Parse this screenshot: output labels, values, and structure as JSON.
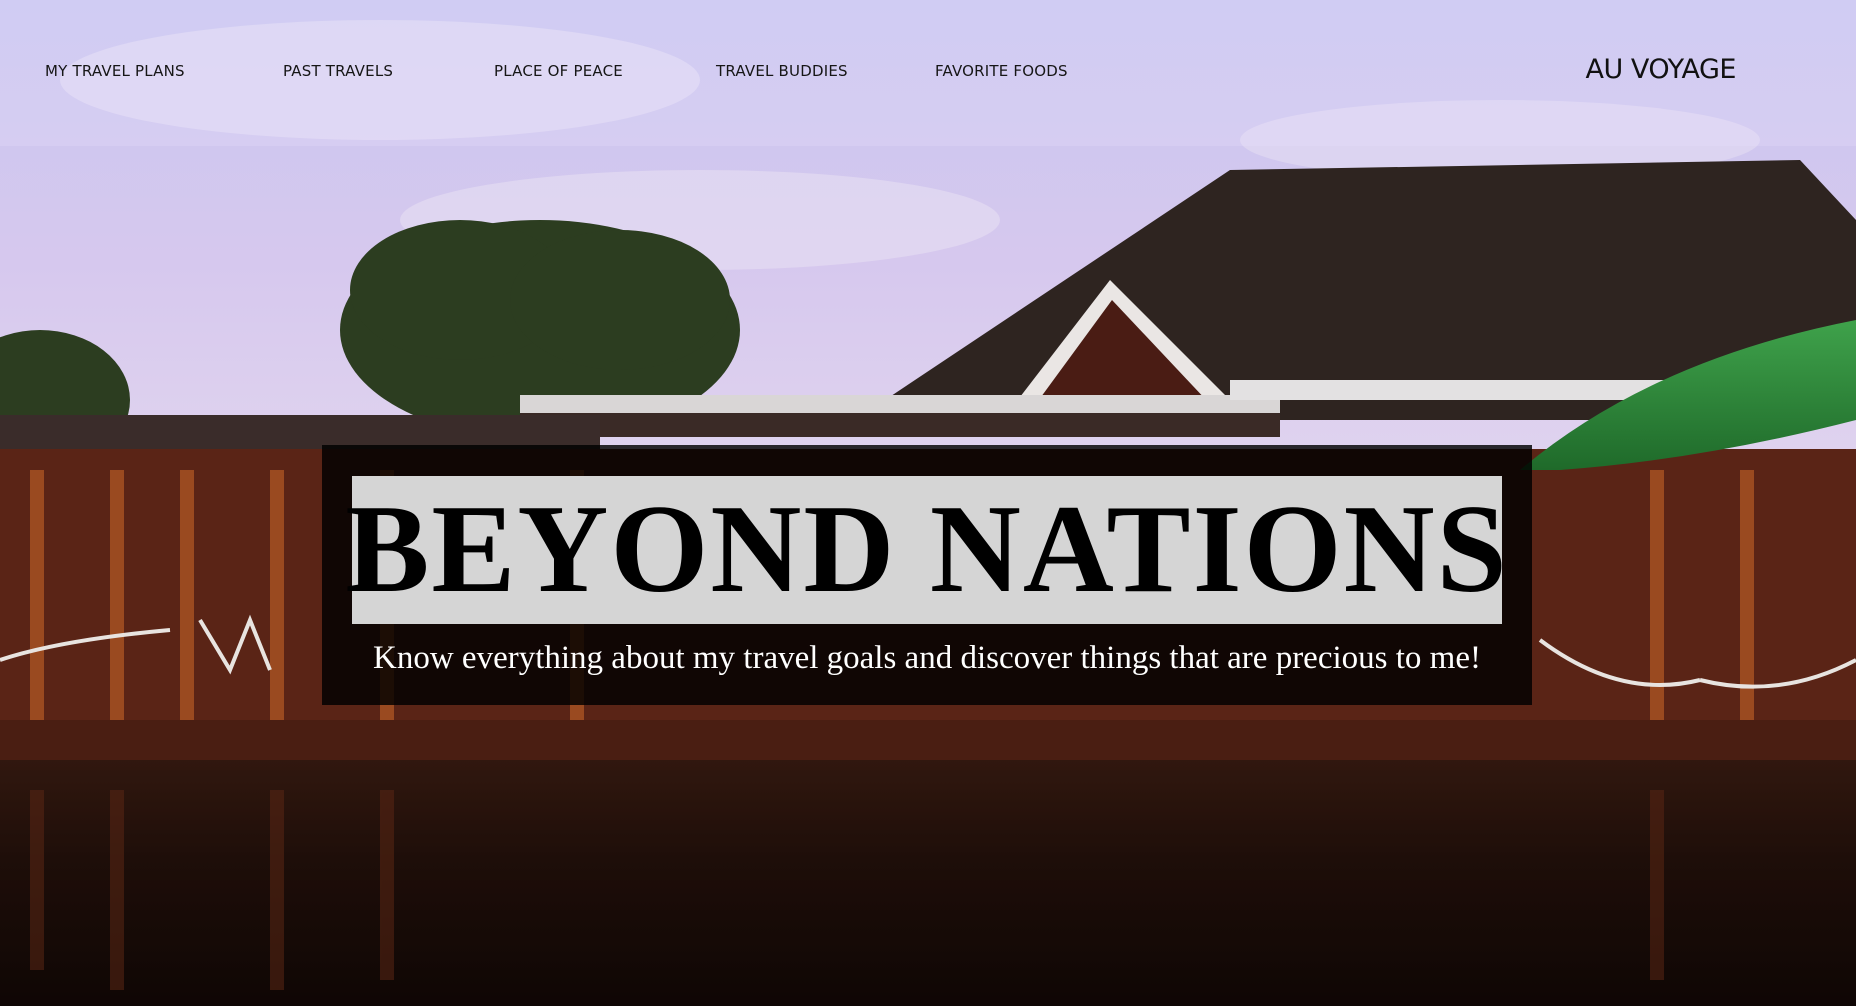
{
  "nav": {
    "items": [
      {
        "label": "MY TRAVEL PLANS"
      },
      {
        "label": "PAST TRAVELS"
      },
      {
        "label": "PLACE OF PEACE"
      },
      {
        "label": "TRAVEL BUDDIES"
      },
      {
        "label": "FAVORITE FOODS"
      }
    ],
    "brand": "AU VOYAGE"
  },
  "hero": {
    "title": "BEYOND NATIONS",
    "subtitle": "Know everything about my travel goals and discover things that are precious to me!"
  },
  "colors": {
    "sky_top": "#c9c6ee",
    "sky_bottom": "#d8c6ec",
    "roof": "#2e2420",
    "wood": "#7a3a1e",
    "water": "#1c0e0a",
    "grass_roof": "#2f8a3a",
    "overlay": "#000000",
    "title_box": "#d5d5d5"
  }
}
